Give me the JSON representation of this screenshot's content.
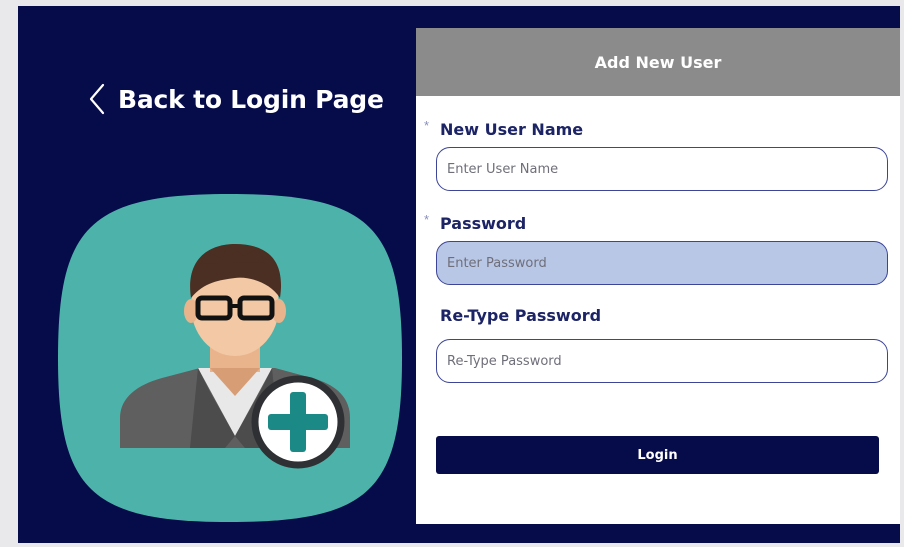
{
  "back_link": {
    "label": "Back to Login Page",
    "icon": "chevron-left-icon"
  },
  "avatar": {
    "icon": "add-user-icon",
    "tile_color": "#4db3aa",
    "plus_color": "#1b8a86"
  },
  "panel": {
    "title": "Add New User",
    "fields": [
      {
        "label": "New User Name",
        "required": true,
        "placeholder": "Enter User Name",
        "value": ""
      },
      {
        "label": "Password",
        "required": true,
        "placeholder": "Enter Password",
        "value": "",
        "focused": true
      },
      {
        "label": "Re-Type Password",
        "required": false,
        "placeholder": "Re-Type Password",
        "value": ""
      }
    ],
    "required_marker": "*",
    "submit_label": "Login"
  },
  "colors": {
    "background": "#060b4a",
    "header": "#8b8b8b",
    "label_text": "#1c2466",
    "input_border": "#3c4597",
    "focused_input": "#b9c7e6",
    "button": "#060b4a"
  }
}
